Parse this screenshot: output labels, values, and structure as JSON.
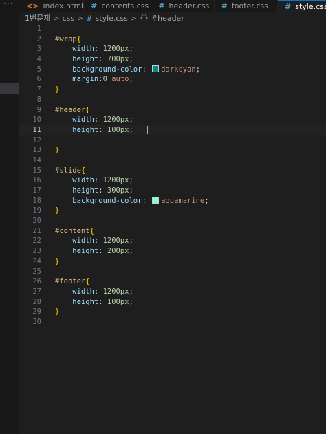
{
  "window": {
    "more_label": "···"
  },
  "tabs": [
    {
      "label": "index.html",
      "icon": "html-file-icon",
      "glyph": "<>"
    },
    {
      "label": "contents.css",
      "icon": "css-file-icon",
      "glyph": "#"
    },
    {
      "label": "header.css",
      "icon": "css-file-icon",
      "glyph": "#"
    },
    {
      "label": "footer.css",
      "icon": "css-file-icon",
      "glyph": "#"
    },
    {
      "label": "style.css",
      "icon": "css-file-icon",
      "glyph": "#",
      "active": true
    }
  ],
  "breadcrumb": {
    "folder": "1번문제",
    "subfolder": "css",
    "file": "style.css",
    "symbol": "#header",
    "separator": ">",
    "file_glyph": "#",
    "symbol_glyph": "{}"
  },
  "editor": {
    "active_line": 11,
    "lines": [
      {
        "n": "1",
        "t": []
      },
      {
        "n": "2",
        "t": [
          [
            "sel",
            "#wrap"
          ],
          [
            "br",
            "{"
          ]
        ]
      },
      {
        "n": "3",
        "t": [
          [
            "ws",
            "    "
          ],
          [
            "prop",
            "width"
          ],
          [
            "punc",
            ": "
          ],
          [
            "num",
            "1200px"
          ],
          [
            "punc",
            ";"
          ]
        ]
      },
      {
        "n": "4",
        "t": [
          [
            "ws",
            "    "
          ],
          [
            "prop",
            "height"
          ],
          [
            "punc",
            ": "
          ],
          [
            "num",
            "700px"
          ],
          [
            "punc",
            ";"
          ]
        ]
      },
      {
        "n": "5",
        "t": [
          [
            "ws",
            "    "
          ],
          [
            "prop",
            "background-color"
          ],
          [
            "punc",
            ": "
          ],
          [
            "swatch",
            "#008b8b"
          ],
          [
            "val",
            "darkcyan"
          ],
          [
            "punc",
            ";"
          ]
        ]
      },
      {
        "n": "6",
        "t": [
          [
            "ws",
            "    "
          ],
          [
            "prop",
            "margin"
          ],
          [
            "punc",
            ":"
          ],
          [
            "num",
            "0"
          ],
          [
            "punc",
            " "
          ],
          [
            "val",
            "auto"
          ],
          [
            "punc",
            ";"
          ]
        ]
      },
      {
        "n": "7",
        "t": [
          [
            "br",
            "}"
          ]
        ]
      },
      {
        "n": "8",
        "t": []
      },
      {
        "n": "9",
        "t": [
          [
            "sel",
            "#header"
          ],
          [
            "br",
            "{"
          ]
        ]
      },
      {
        "n": "10",
        "t": [
          [
            "ws",
            "    "
          ],
          [
            "prop",
            "width"
          ],
          [
            "punc",
            ": "
          ],
          [
            "num",
            "1200px"
          ],
          [
            "punc",
            ";"
          ]
        ]
      },
      {
        "n": "11",
        "t": [
          [
            "ws",
            "    "
          ],
          [
            "prop",
            "height"
          ],
          [
            "punc",
            ": "
          ],
          [
            "num",
            "100px"
          ],
          [
            "punc",
            ";"
          ]
        ]
      },
      {
        "n": "12",
        "t": []
      },
      {
        "n": "13",
        "t": [
          [
            "br",
            "}"
          ]
        ]
      },
      {
        "n": "14",
        "t": []
      },
      {
        "n": "15",
        "t": [
          [
            "sel",
            "#slide"
          ],
          [
            "br",
            "{"
          ]
        ]
      },
      {
        "n": "16",
        "t": [
          [
            "ws",
            "    "
          ],
          [
            "prop",
            "width"
          ],
          [
            "punc",
            ": "
          ],
          [
            "num",
            "1200px"
          ],
          [
            "punc",
            ";"
          ]
        ]
      },
      {
        "n": "17",
        "t": [
          [
            "ws",
            "    "
          ],
          [
            "prop",
            "height"
          ],
          [
            "punc",
            ": "
          ],
          [
            "num",
            "300px"
          ],
          [
            "punc",
            ";"
          ]
        ]
      },
      {
        "n": "18",
        "t": [
          [
            "ws",
            "    "
          ],
          [
            "prop",
            "background-color"
          ],
          [
            "punc",
            ": "
          ],
          [
            "swatch",
            "#7fffd4"
          ],
          [
            "val",
            "aquamarine"
          ],
          [
            "punc",
            ";"
          ]
        ]
      },
      {
        "n": "19",
        "t": [
          [
            "br",
            "}"
          ]
        ]
      },
      {
        "n": "20",
        "t": []
      },
      {
        "n": "21",
        "t": [
          [
            "sel",
            "#content"
          ],
          [
            "br",
            "{"
          ]
        ]
      },
      {
        "n": "22",
        "t": [
          [
            "ws",
            "    "
          ],
          [
            "prop",
            "width"
          ],
          [
            "punc",
            ": "
          ],
          [
            "num",
            "1200px"
          ],
          [
            "punc",
            ";"
          ]
        ]
      },
      {
        "n": "23",
        "t": [
          [
            "ws",
            "    "
          ],
          [
            "prop",
            "height"
          ],
          [
            "punc",
            ": "
          ],
          [
            "num",
            "200px"
          ],
          [
            "punc",
            ";"
          ]
        ]
      },
      {
        "n": "24",
        "t": [
          [
            "br",
            "}"
          ]
        ]
      },
      {
        "n": "25",
        "t": []
      },
      {
        "n": "26",
        "t": [
          [
            "sel",
            "#footer"
          ],
          [
            "br",
            "{"
          ]
        ]
      },
      {
        "n": "27",
        "t": [
          [
            "ws",
            "    "
          ],
          [
            "prop",
            "width"
          ],
          [
            "punc",
            ": "
          ],
          [
            "num",
            "1200px"
          ],
          [
            "punc",
            ";"
          ]
        ]
      },
      {
        "n": "28",
        "t": [
          [
            "ws",
            "    "
          ],
          [
            "prop",
            "height"
          ],
          [
            "punc",
            ": "
          ],
          [
            "num",
            "100px"
          ],
          [
            "punc",
            ";"
          ]
        ]
      },
      {
        "n": "29",
        "t": [
          [
            "br",
            "}"
          ]
        ]
      },
      {
        "n": "30",
        "t": []
      }
    ]
  }
}
